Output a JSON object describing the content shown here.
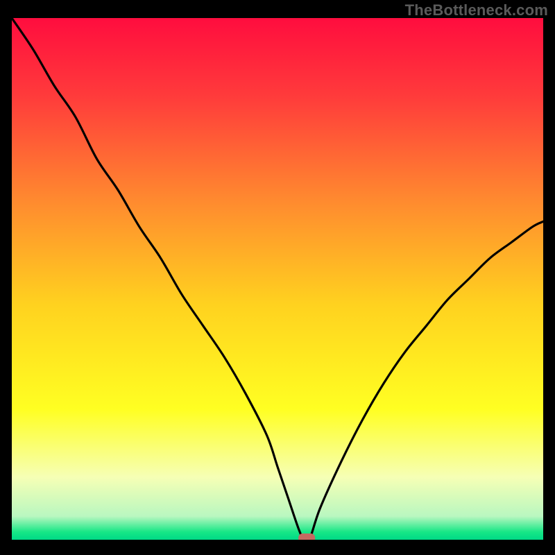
{
  "watermark": "TheBottleneck.com",
  "chart_data": {
    "type": "line",
    "title": "",
    "xlabel": "",
    "ylabel": "",
    "xlim": [
      0,
      100
    ],
    "ylim": [
      0,
      100
    ],
    "grid": false,
    "legend": false,
    "annotations": [],
    "series": [
      {
        "name": "bottleneck-curve",
        "x": [
          0,
          4,
          8,
          12,
          16,
          20,
          24,
          28,
          32,
          36,
          40,
          44,
          48,
          50,
          52,
          54,
          55,
          56,
          58,
          62,
          66,
          70,
          74,
          78,
          82,
          86,
          90,
          94,
          98,
          100
        ],
        "values": [
          100,
          94,
          87,
          81,
          73,
          67,
          60,
          54,
          47,
          41,
          35,
          28,
          20,
          14,
          8,
          2,
          0,
          0,
          6,
          15,
          23,
          30,
          36,
          41,
          46,
          50,
          54,
          57,
          60,
          61
        ]
      }
    ],
    "marker": {
      "x": 55.5,
      "y": 0,
      "color": "#c46a61"
    },
    "background_gradient": {
      "type": "vertical",
      "stops": [
        {
          "offset": 0.0,
          "color": "#ff0d3e"
        },
        {
          "offset": 0.15,
          "color": "#ff3b3b"
        },
        {
          "offset": 0.35,
          "color": "#ff8a2f"
        },
        {
          "offset": 0.55,
          "color": "#ffd21f"
        },
        {
          "offset": 0.75,
          "color": "#ffff22"
        },
        {
          "offset": 0.88,
          "color": "#f6ffb5"
        },
        {
          "offset": 0.955,
          "color": "#b9f7c0"
        },
        {
          "offset": 0.985,
          "color": "#17e786"
        },
        {
          "offset": 1.0,
          "color": "#00d986"
        }
      ]
    }
  }
}
